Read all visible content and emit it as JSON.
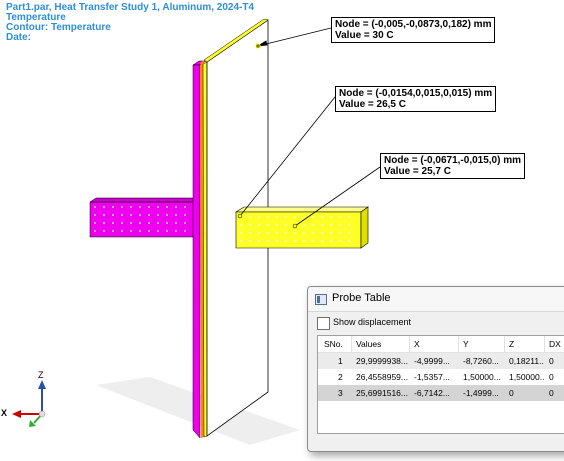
{
  "header": {
    "line1": "Part1.par, Heat Transfer Study 1, Aluminum, 2024-T4",
    "line2": "Temperature",
    "line3": "Contour: Temperature",
    "line4": "Date:"
  },
  "colors": {
    "header_text": "#2e8fd8",
    "magenta": "#ee00ee",
    "yellow": "#ffff28",
    "outline": "#000000"
  },
  "probes": [
    {
      "node": "Node = (-0,005,-0,0873,0,182) mm",
      "value": "Value = 30 C"
    },
    {
      "node": "Node = (-0,0154,0,015,0,015) mm",
      "value": "Value = 26,5 C"
    },
    {
      "node": "Node = (-0,0671,-0,015,0) mm",
      "value": "Value = 25,7 C"
    }
  ],
  "triad": {
    "x": "X",
    "z": "Z"
  },
  "probe_table": {
    "title": "Probe Table",
    "show_displacement_label": "Show displacement",
    "show_displacement_checked": false,
    "columns": [
      "SNo.",
      "Values",
      "X",
      "Y",
      "Z",
      "DX"
    ],
    "rows": [
      [
        "1",
        "29,9999938...",
        "-4,9999...",
        "-8,7260...",
        "0,18211...",
        "0"
      ],
      [
        "2",
        "26,4558959...",
        "-1,5357...",
        "1,50000...",
        "1,50000...",
        "0"
      ],
      [
        "3",
        "25,6991516...",
        "-6,7142...",
        "-1,4999...",
        "0",
        "0"
      ]
    ]
  }
}
